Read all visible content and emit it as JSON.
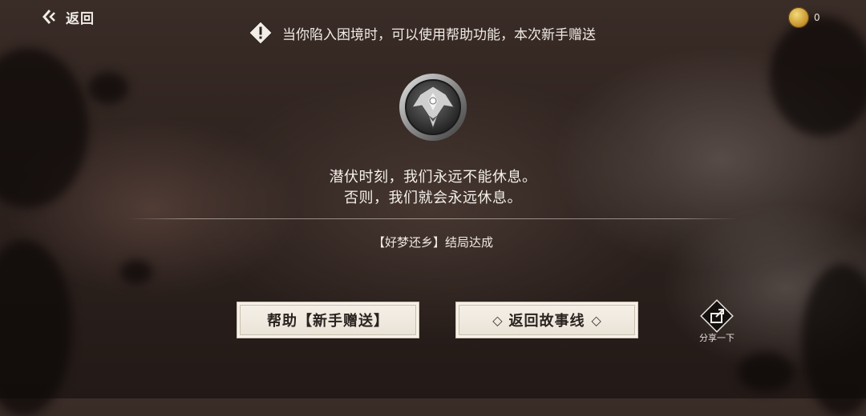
{
  "header": {
    "back_label": "返回",
    "coin_count": "0"
  },
  "hint": {
    "text": "当你陷入困境时，可以使用帮助功能，本次新手赠送"
  },
  "quote": {
    "line1": "潜伏时刻，我们永远不能休息。",
    "line2": "否则，我们就会永远休息。"
  },
  "ending": {
    "text": "【好梦还乡】结局达成"
  },
  "buttons": {
    "help_label": "帮助【新手赠送】",
    "return_label": "返回故事线",
    "return_left_deco": "◇",
    "return_right_deco": "◇"
  },
  "share": {
    "label": "分享一下"
  },
  "icons": {
    "back": "chevron-left-icon",
    "coin": "coin-icon",
    "hint": "exclamation-diamond-icon",
    "emblem": "bee-emblem-icon",
    "share": "share-icon"
  }
}
